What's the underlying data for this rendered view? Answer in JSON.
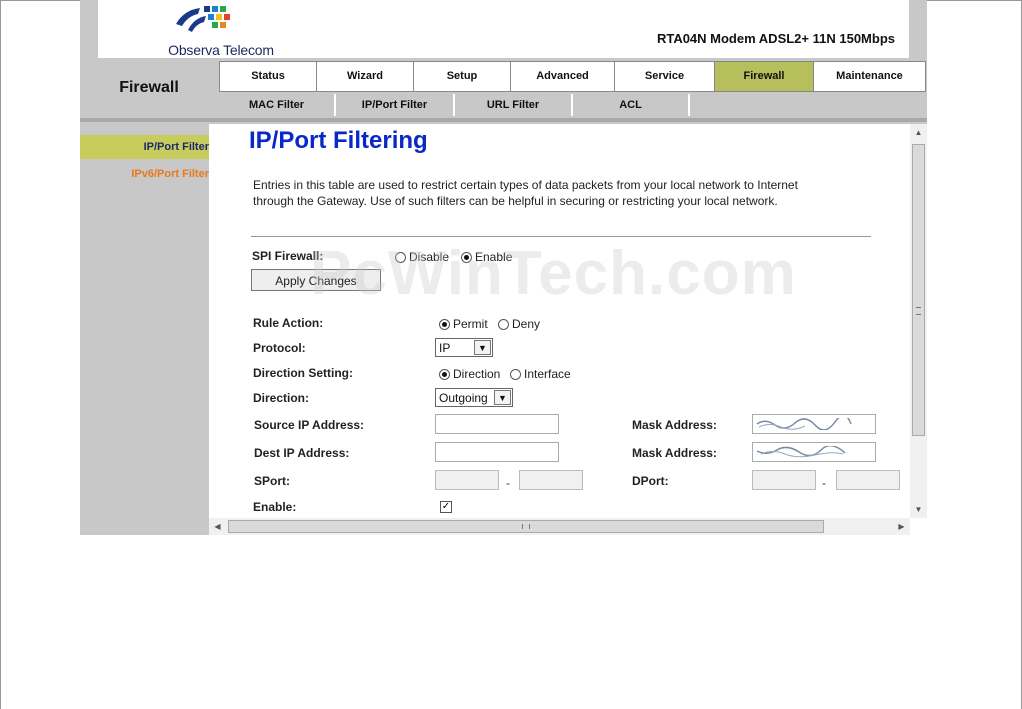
{
  "banner": {
    "logo_text": "Observa Telecom",
    "model": "RTA04N Modem ADSL2+ 11N 150Mbps"
  },
  "section_title": "Firewall",
  "tabs": [
    {
      "label": "Status",
      "active": false
    },
    {
      "label": "Wizard",
      "active": false
    },
    {
      "label": "Setup",
      "active": false
    },
    {
      "label": "Advanced",
      "active": false
    },
    {
      "label": "Service",
      "active": false
    },
    {
      "label": "Firewall",
      "active": true
    },
    {
      "label": "Maintenance",
      "active": false
    }
  ],
  "subtabs": [
    {
      "label": "MAC Filter"
    },
    {
      "label": "IP/Port Filter"
    },
    {
      "label": "URL Filter"
    },
    {
      "label": "ACL"
    }
  ],
  "sidebar": {
    "items": [
      {
        "label": "IP/Port Filter",
        "active": true
      },
      {
        "label": "IPv6/Port Filter",
        "active": false
      }
    ]
  },
  "page": {
    "title": "IP/Port Filtering",
    "description": "Entries in this table are used to restrict certain types of data packets from your local network to Internet through the Gateway. Use of such filters can be helpful in securing or restricting your local network."
  },
  "spi": {
    "label": "SPI Firewall:",
    "options": [
      {
        "label": "Disable",
        "selected": false
      },
      {
        "label": "Enable",
        "selected": true
      }
    ],
    "apply_label": "Apply Changes"
  },
  "form": {
    "rule_action": {
      "label": "Rule Action:",
      "options": [
        {
          "label": "Permit",
          "selected": true
        },
        {
          "label": "Deny",
          "selected": false
        }
      ]
    },
    "protocol": {
      "label": "Protocol:",
      "value": "IP"
    },
    "direction_setting": {
      "label": "Direction Setting:",
      "options": [
        {
          "label": "Direction",
          "selected": true
        },
        {
          "label": "Interface",
          "selected": false
        }
      ]
    },
    "direction": {
      "label": "Direction:",
      "value": "Outgoing"
    },
    "source_ip": {
      "label": "Source IP Address:",
      "value": ""
    },
    "source_mask": {
      "label": "Mask Address:"
    },
    "dest_ip": {
      "label": "Dest IP Address:",
      "value": ""
    },
    "dest_mask": {
      "label": "Mask Address:"
    },
    "sport": {
      "label": "SPort:",
      "separator": "-"
    },
    "dport": {
      "label": "DPort:",
      "separator": "-"
    },
    "enable": {
      "label": "Enable:",
      "checked": true
    }
  },
  "watermark": "PcWinTech.com",
  "colors": {
    "active_tab": "#b7bf5c",
    "sidebar_active": "#c8cc5c",
    "sidebar_inactive": "#e67a1c",
    "title": "#0a28c8",
    "frame": "#c8c8c8"
  }
}
